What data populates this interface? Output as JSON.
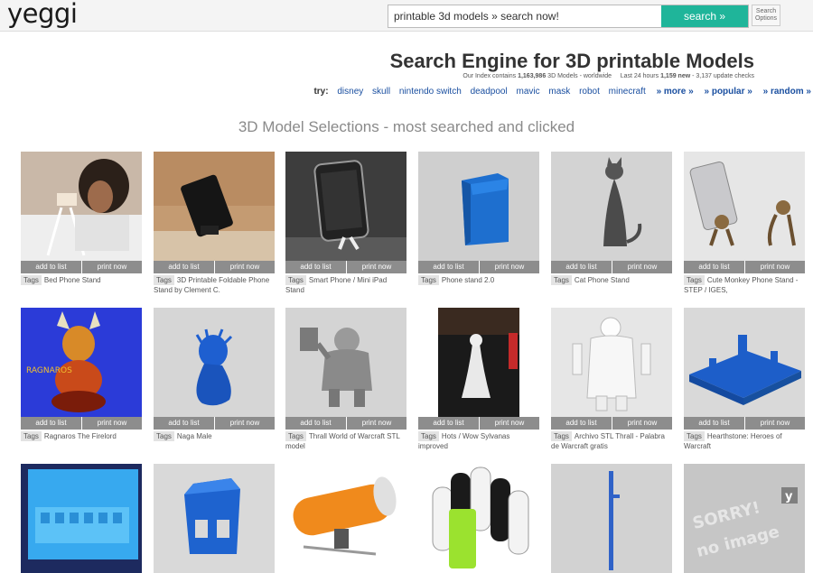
{
  "header": {
    "logo": "yeggi",
    "search_value": "printable 3d models » search now!",
    "search_button": "search »",
    "options_line1": "Search",
    "options_line2": "Options"
  },
  "hero": {
    "title": "Search Engine for 3D printable Models",
    "index_prefix": "Our Index contains ",
    "index_count": "1,163,986",
    "index_suffix": " 3D Models - worldwide",
    "last24_prefix": "Last 24 hours ",
    "last24_new": "1,159 new",
    "last24_suffix": " - 3,137 update checks",
    "try_label": "try:",
    "try_links": [
      "disney",
      "skull",
      "nintendo switch",
      "deadpool",
      "mavic",
      "mask",
      "robot",
      "minecraft"
    ],
    "more": "» more »",
    "popular": "» popular »",
    "random": "» random »"
  },
  "section_title": "3D Model Selections - most searched and clicked",
  "labels": {
    "add": "add to list",
    "print": "print now",
    "tags": "Tags"
  },
  "rows": [
    [
      {
        "title": "Bed Phone Stand",
        "bg": "#c8b6a6"
      },
      {
        "title": "3D Printable Foldable Phone Stand by Clement C.",
        "bg": "#c29a72"
      },
      {
        "title": "Smart Phone / Mini iPad Stand",
        "bg": "#3f3f3f"
      },
      {
        "title": "Phone stand 2.0",
        "bg": "#cfcfcf"
      },
      {
        "title": "Cat Phone Stand",
        "bg": "#d2d2d2"
      },
      {
        "title": "Cute Monkey Phone Stand - STEP / IGES,",
        "bg": "#e4e4e4"
      }
    ],
    [
      {
        "title": "Ragnaros The Firelord",
        "bg": "#2a3ad8"
      },
      {
        "title": "Naga Male",
        "bg": "#d6d6d6"
      },
      {
        "title": "Thrall World of Warcraft STL model",
        "bg": "#d4d4d4"
      },
      {
        "title": "Hots / Wow Sylvanas improved",
        "bg": "#ffffff"
      },
      {
        "title": "Archivo STL Thrall - Palabra de Warcraft gratis",
        "bg": "#e6e6e6"
      },
      {
        "title": "Hearthstone: Heroes of Warcraft",
        "bg": "#d9d9d9"
      }
    ],
    [
      {
        "title": "",
        "bg": "#1d2a5f"
      },
      {
        "title": "",
        "bg": "#d9d9d9"
      },
      {
        "title": "",
        "bg": "#ffffff"
      },
      {
        "title": "",
        "bg": "#ffffff"
      },
      {
        "title": "",
        "bg": "#d2d2d2"
      },
      {
        "title": "",
        "bg": "#c8c8c8"
      }
    ]
  ],
  "no_image": {
    "line1": "SORRY!",
    "line2": "no image",
    "badge": "y"
  }
}
